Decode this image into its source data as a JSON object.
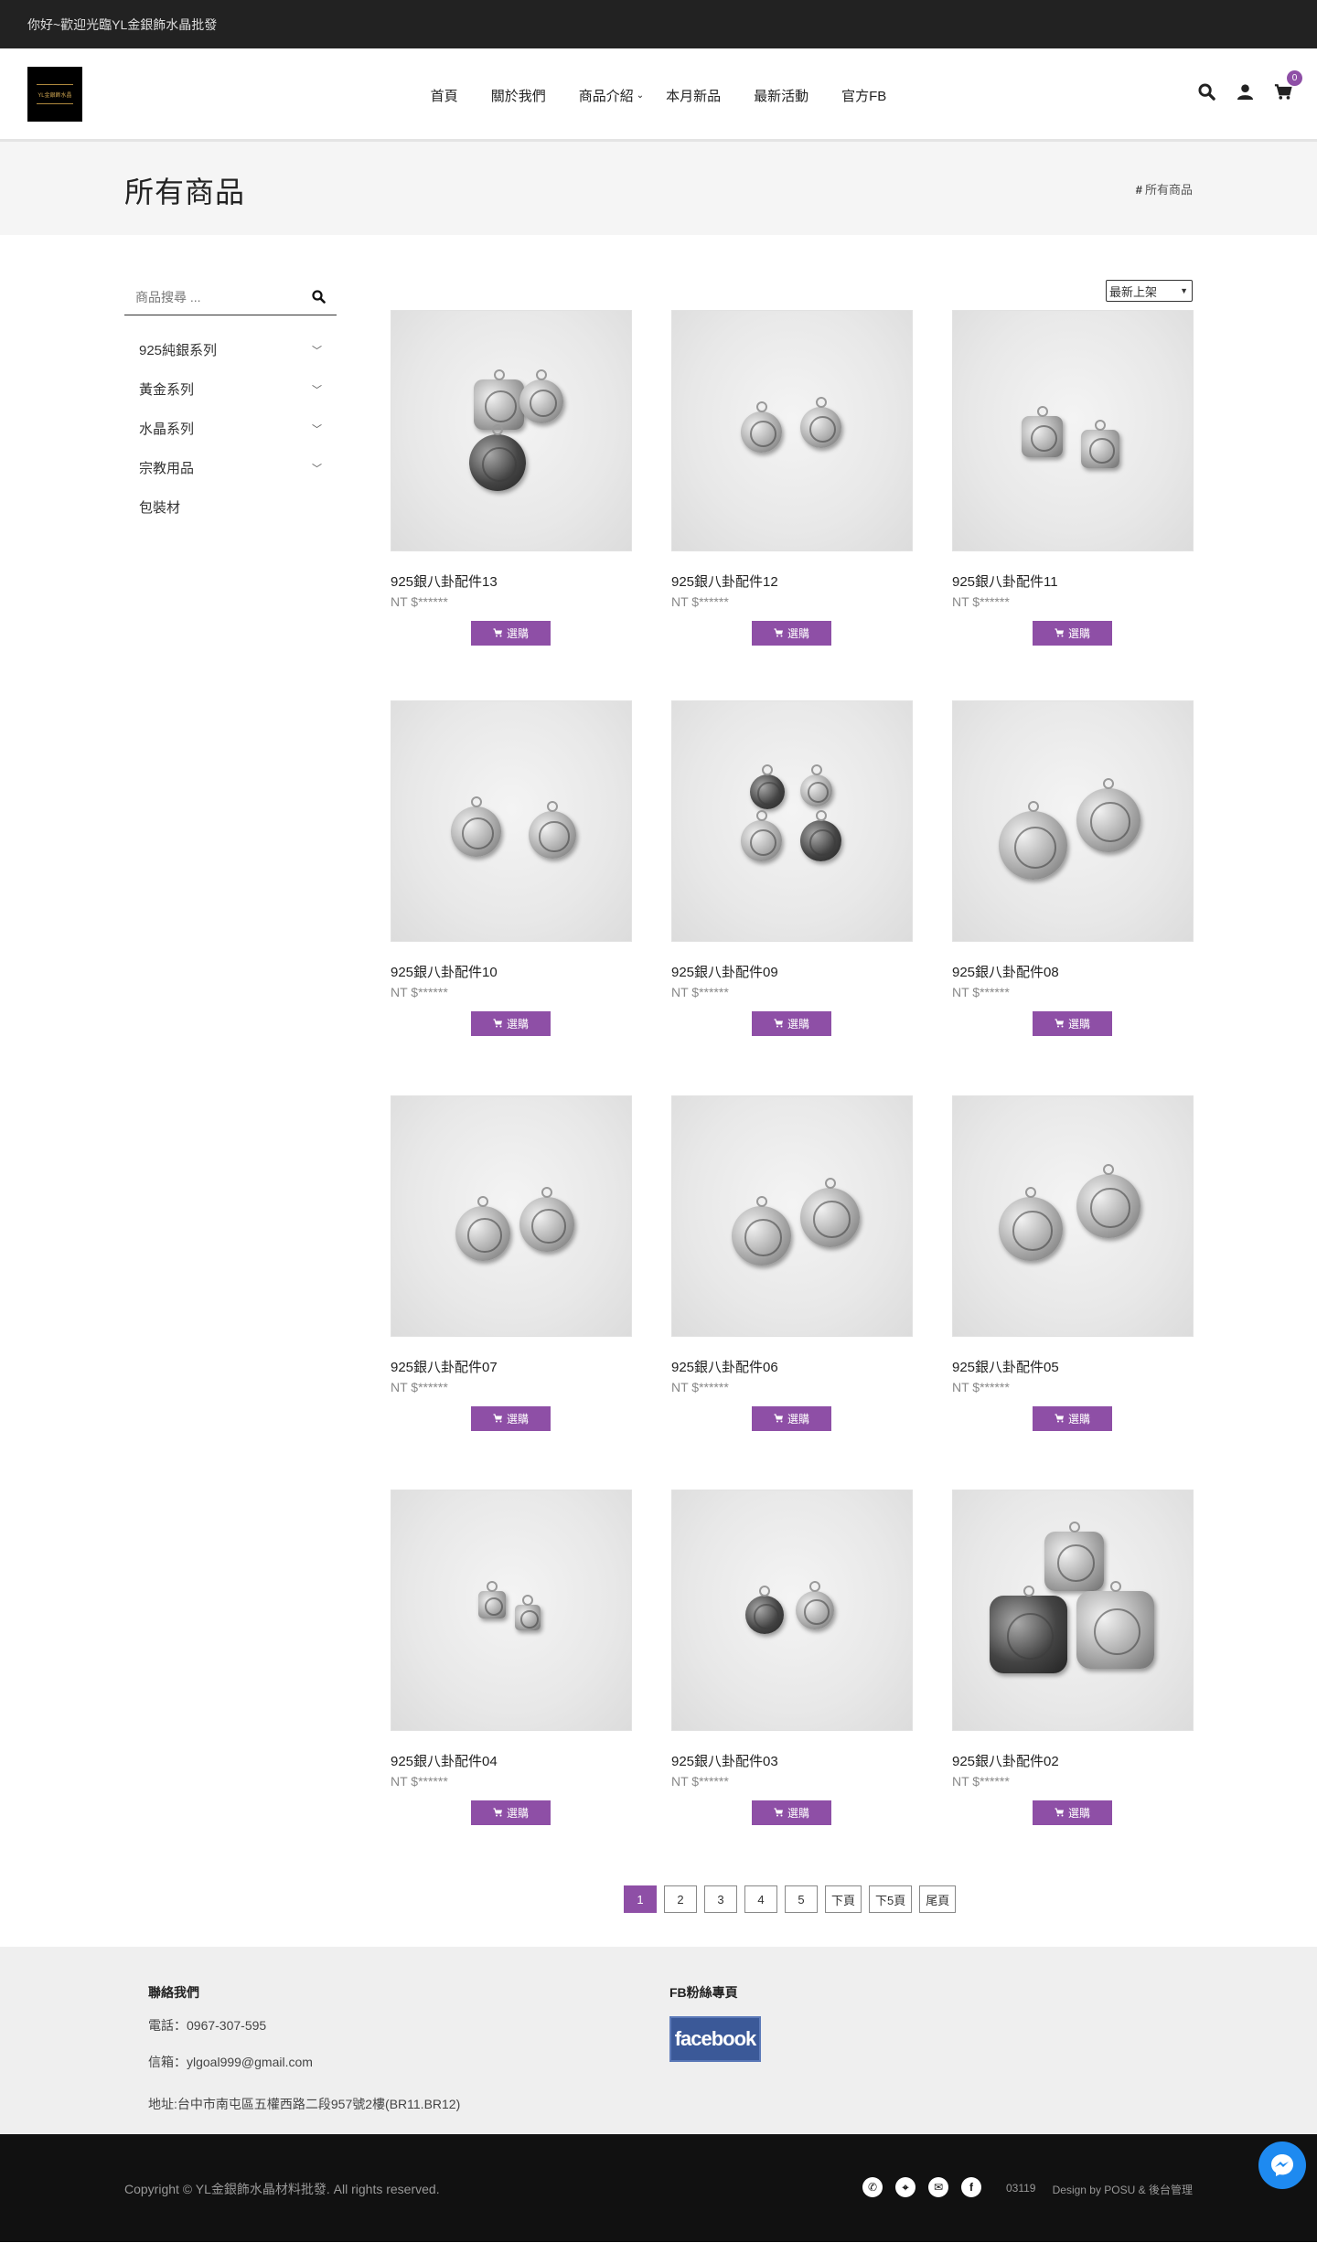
{
  "topbar": {
    "welcome": "你好~歡迎光臨YL金銀飾水晶批發"
  },
  "header": {
    "logo_text": "YL金銀飾水晶",
    "nav": [
      {
        "label": "首頁"
      },
      {
        "label": "關於我們"
      },
      {
        "label": "商品介紹"
      },
      {
        "label": "本月新品"
      },
      {
        "label": "最新活動"
      },
      {
        "label": "官方FB"
      }
    ],
    "cart_count": "0"
  },
  "page": {
    "title": "所有商品",
    "breadcrumb": "所有商品"
  },
  "sidebar": {
    "search_placeholder": "商品搜尋 ...",
    "categories": [
      {
        "label": "925純銀系列"
      },
      {
        "label": "黃金系列"
      },
      {
        "label": "水晶系列"
      },
      {
        "label": "宗教用品"
      },
      {
        "label": "包裝材"
      }
    ]
  },
  "sort": {
    "selected": "最新上架"
  },
  "products": [
    {
      "name": "925銀八卦配件13",
      "price": "NT $******",
      "button": "選購"
    },
    {
      "name": "925銀八卦配件12",
      "price": "NT $******",
      "button": "選購"
    },
    {
      "name": "925銀八卦配件11",
      "price": "NT $******",
      "button": "選購"
    },
    {
      "name": "925銀八卦配件10",
      "price": "NT $******",
      "button": "選購"
    },
    {
      "name": "925銀八卦配件09",
      "price": "NT $******",
      "button": "選購"
    },
    {
      "name": "925銀八卦配件08",
      "price": "NT $******",
      "button": "選購"
    },
    {
      "name": "925銀八卦配件07",
      "price": "NT $******",
      "button": "選購"
    },
    {
      "name": "925銀八卦配件06",
      "price": "NT $******",
      "button": "選購"
    },
    {
      "name": "925銀八卦配件05",
      "price": "NT $******",
      "button": "選購"
    },
    {
      "name": "925銀八卦配件04",
      "price": "NT $******",
      "button": "選購"
    },
    {
      "name": "925銀八卦配件03",
      "price": "NT $******",
      "button": "選購"
    },
    {
      "name": "925銀八卦配件02",
      "price": "NT $******",
      "button": "選購"
    }
  ],
  "pagination": {
    "pages": [
      "1",
      "2",
      "3",
      "4",
      "5"
    ],
    "next": "下頁",
    "next5": "下5頁",
    "last": "尾頁",
    "active": "1"
  },
  "footer": {
    "contact_heading": "聯絡我們",
    "phone": "電話：0967-307-595",
    "email": "信箱：ylgoal999@gmail.com",
    "address": "地址:台中市南屯區五權西路二段957號2樓(BR11.BR12)",
    "fb_heading": "FB粉絲專頁",
    "fb_logo": "facebook"
  },
  "bottom": {
    "copyright": "Copyright © YL金銀飾水晶材料批發. All rights reserved.",
    "counter": "03119",
    "design": "Design by POSU & 後台管理"
  },
  "colors": {
    "accent": "#8e4fa6",
    "topbar": "#222222",
    "bottombar": "#111111"
  }
}
